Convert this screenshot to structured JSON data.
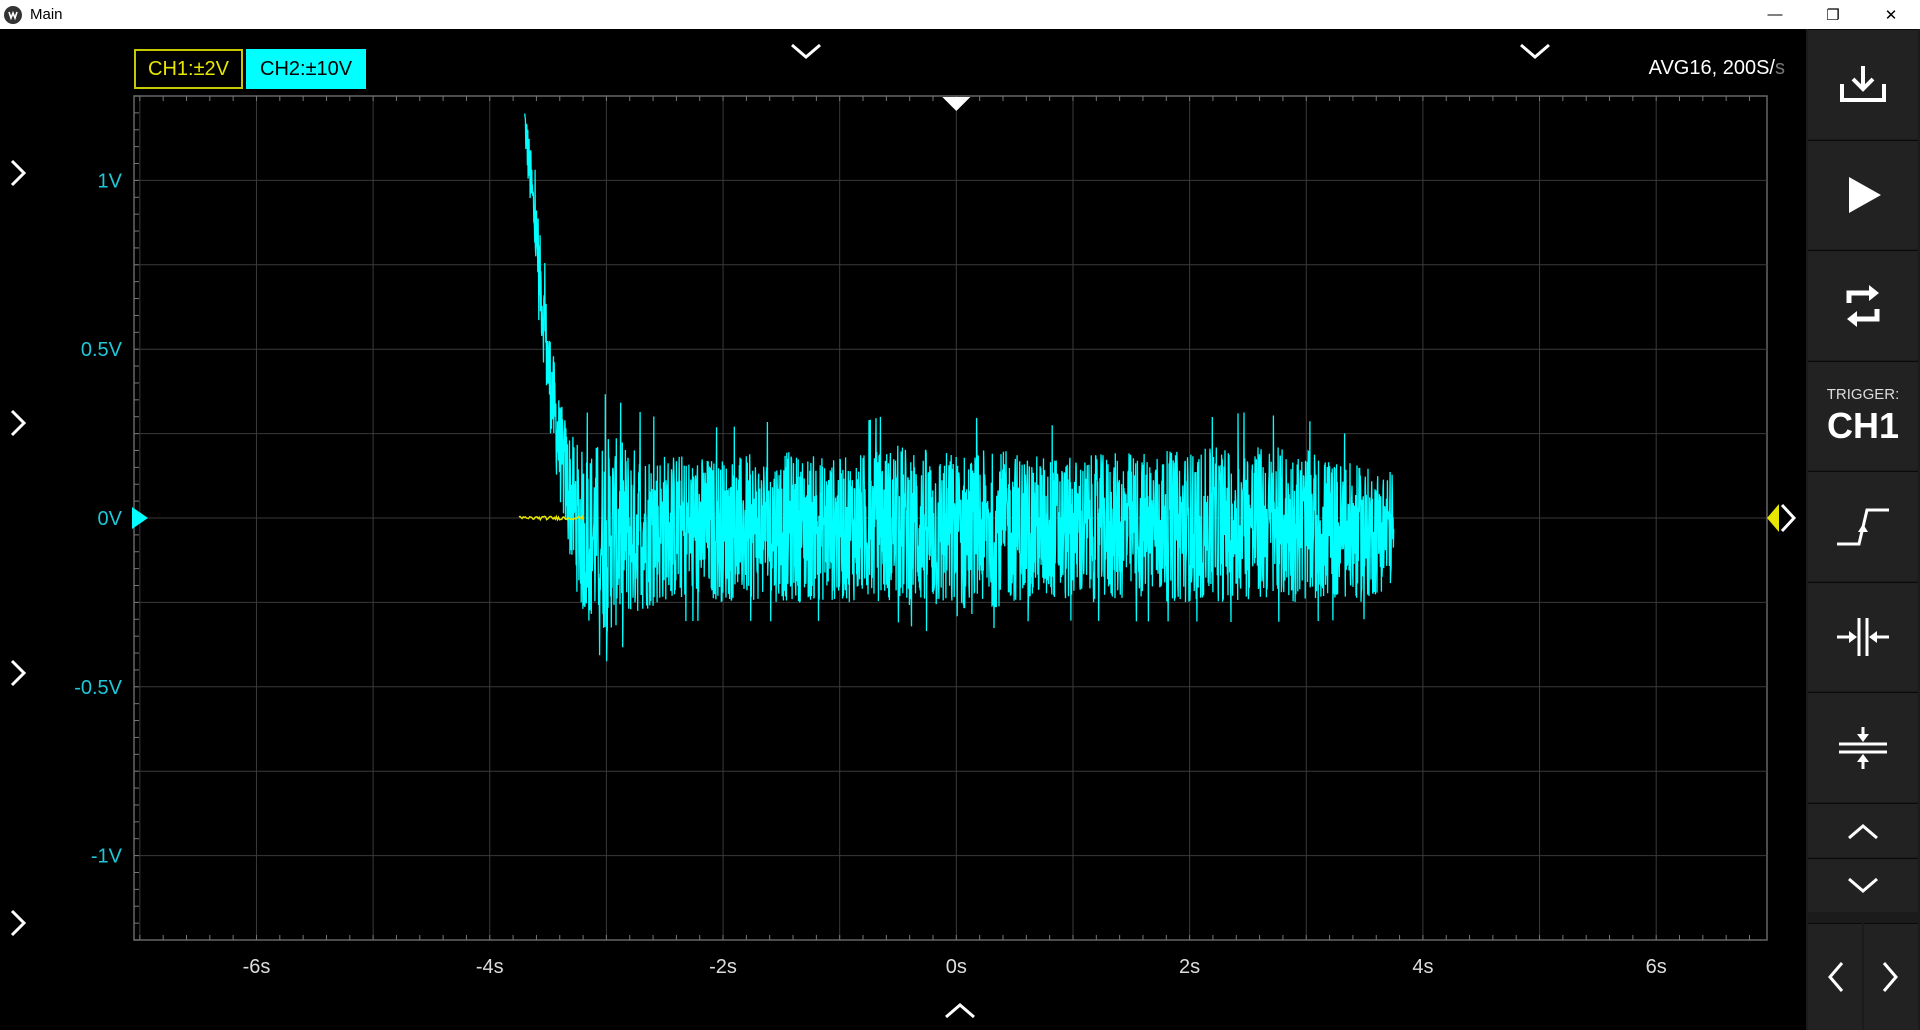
{
  "window": {
    "title": "Main",
    "minimize_glyph": "—",
    "restore_glyph": "❐",
    "close_glyph": "✕"
  },
  "channels": {
    "ch1_label": "CH1:±2V",
    "ch2_label": "CH2:±10V"
  },
  "acquisition": {
    "mode_text": "AVG16, 200S/",
    "unit_suffix": "s"
  },
  "axes": {
    "y_ticks": [
      {
        "label": "1V",
        "value": 1
      },
      {
        "label": "0.5V",
        "value": 0.5
      },
      {
        "label": "0V",
        "value": 0
      },
      {
        "label": "-0.5V",
        "value": -0.5
      },
      {
        "label": "-1V",
        "value": -1
      }
    ],
    "x_ticks": [
      {
        "label": "-6s",
        "value": -6
      },
      {
        "label": "-4s",
        "value": -4
      },
      {
        "label": "-2s",
        "value": -2
      },
      {
        "label": "0s",
        "value": 0
      },
      {
        "label": "2s",
        "value": 2
      },
      {
        "label": "4s",
        "value": 4
      },
      {
        "label": "6s",
        "value": 6
      }
    ],
    "x_range": [
      -7.05,
      6.95
    ],
    "y_range": [
      -1.25,
      1.25
    ]
  },
  "chart_data": {
    "type": "line",
    "xlim": [
      -7.05,
      6.95
    ],
    "ylim": [
      -1.25,
      1.25
    ],
    "grid": true,
    "series": [
      {
        "name": "CH2:±10V",
        "color": "#00ffff",
        "envelope_x": [
          -3.7,
          -3.6,
          -3.5,
          -3.4,
          -3.3,
          -3.2,
          -3.0,
          -2.8,
          -2.5,
          -2.0,
          -1.5,
          -1.0,
          -0.5,
          0,
          0.5,
          1.0,
          1.5,
          2.0,
          2.5,
          3.0,
          3.5,
          3.75
        ],
        "envelope_max": [
          1.25,
          0.95,
          0.6,
          0.35,
          0.25,
          0.2,
          0.25,
          0.22,
          0.2,
          0.18,
          0.2,
          0.18,
          0.22,
          0.2,
          0.2,
          0.18,
          0.2,
          0.2,
          0.22,
          0.2,
          0.15,
          0.15
        ],
        "envelope_min": [
          1.1,
          0.7,
          0.3,
          0.05,
          -0.15,
          -0.3,
          -0.35,
          -0.3,
          -0.25,
          -0.25,
          -0.25,
          -0.25,
          -0.25,
          -0.3,
          -0.25,
          -0.25,
          -0.25,
          -0.25,
          -0.25,
          -0.25,
          -0.25,
          -0.2
        ]
      },
      {
        "name": "CH1:±2V",
        "color": "#e6e600",
        "x": [
          -3.75,
          -3.2
        ],
        "y": [
          0,
          0
        ]
      }
    ]
  },
  "markers": {
    "ch2_offset_color": "#00ffff",
    "trigger_level_color": "#e6e600"
  },
  "toolbar": {
    "trigger_label": "TRIGGER:",
    "trigger_channel": "CH1"
  }
}
